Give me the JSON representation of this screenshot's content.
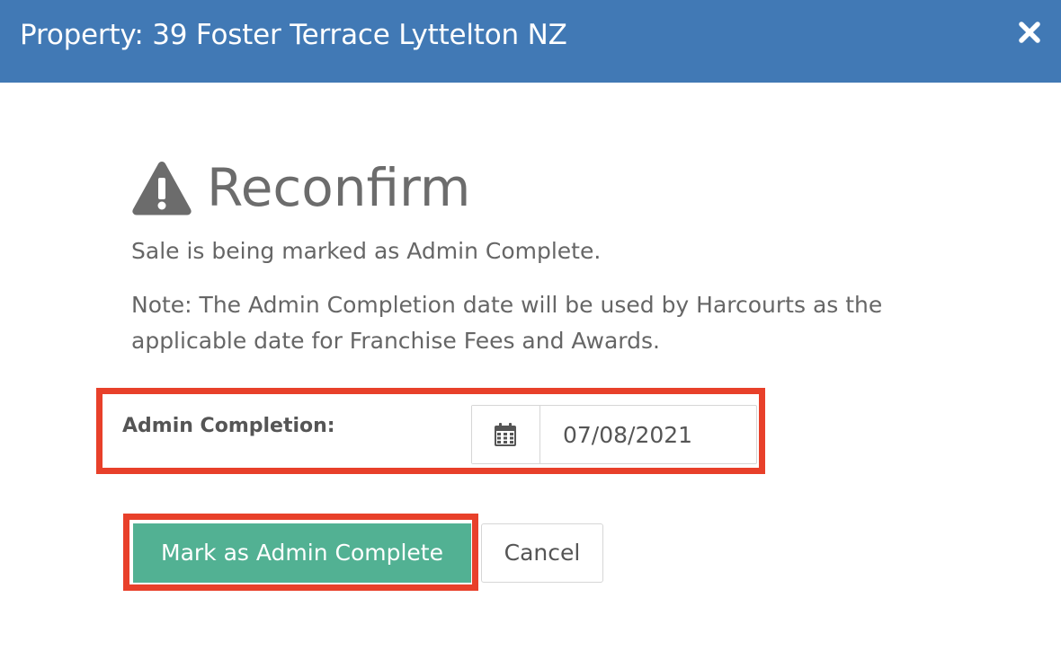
{
  "header": {
    "title": "Property: 39 Foster Terrace Lyttelton NZ",
    "background_color": "#4179b5",
    "close_icon": "close-icon"
  },
  "dialog": {
    "heading_icon": "warning-icon",
    "heading": "Reconfirm",
    "message": "Sale is being marked as Admin Complete.",
    "note": "Note: The Admin Completion date will be used by Harcourts as the applicable date for Franchise Fees and Awards.",
    "note_line1": "Note: The Admin Completion date will be used by Harcourts as the",
    "note_line2": "applicable date for Franchise Fees and Awards."
  },
  "form": {
    "admin_completion_label": "Admin Completion:",
    "date_icon": "calendar-icon",
    "admin_completion_value": "07/08/2021"
  },
  "actions": {
    "confirm_label": "Mark as Admin Complete",
    "cancel_label": "Cancel",
    "confirm_color": "#52b193"
  },
  "highlight_color": "#e8402a"
}
